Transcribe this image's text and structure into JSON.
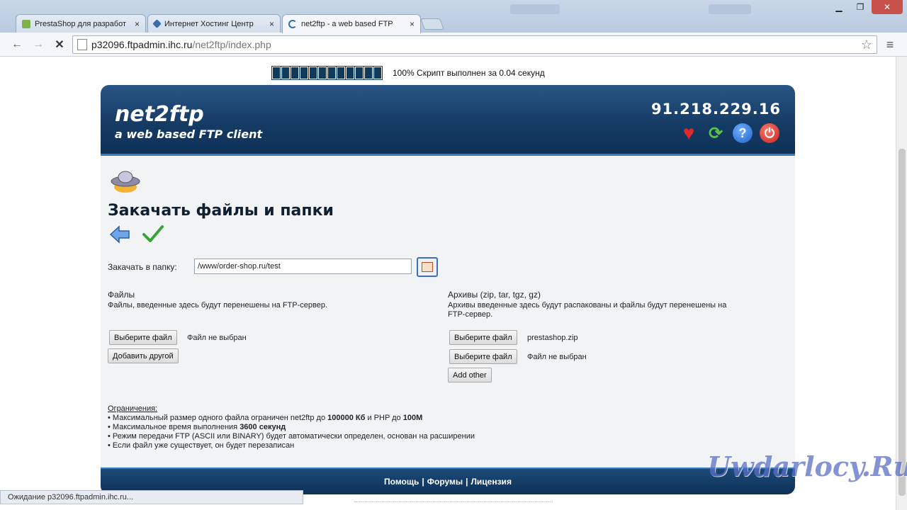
{
  "browser": {
    "tabs": [
      {
        "label": "PrestaShop для разработ",
        "icon_color": "#7fb24a"
      },
      {
        "label": "Интернет Хостинг Центр",
        "icon_color": "#3b6ea8"
      },
      {
        "label": "net2ftp - a web based FTP",
        "icon_color": "#2a6fb0"
      }
    ],
    "tab_close": "×",
    "url_host": "p32096.ftpadmin.ihc.ru",
    "url_path": "/net2ftp/index.php",
    "status_text": "Ожидание p32096.ftpadmin.ihc.ru..."
  },
  "page": {
    "progress": {
      "percent": 100,
      "blocks": 12,
      "text": "100% Скрипт выполнен за 0.04 секунд"
    },
    "logo_line1": "net2ftp",
    "logo_line2": "a web based FTP client",
    "ip": "91.218.229.16",
    "title": "Закачать файлы и папки",
    "dir_label": "Закачать в папку:",
    "dir_value": "/www/order-shop.ru/test",
    "files": {
      "heading": "Файлы",
      "description": "Файлы, введенные здесь будут перенешены на FTP-сервер.",
      "choose_button": "Выберите файл",
      "status": "Файл не выбран",
      "add_button": "Добавить другой"
    },
    "archives": {
      "heading": "Архивы (zip, tar, tgz, gz)",
      "description_line1": "Архивы введенные здесь будут распакованы и файлы будут перенешены на",
      "description_line2": "FTP-сервер.",
      "choose_button_1": "Выберите файл",
      "status_1": "prestashop.zip",
      "choose_button_2": "Выберите файл",
      "status_2": "Файл не выбран",
      "add_button": "Add other"
    },
    "limits": {
      "heading": "Ограничения:",
      "item1_prefix": "Максимальный размер одного файла ограничен net2ftp до ",
      "item1_bold1": "100000 Кб",
      "item1_mid": " и PHP до ",
      "item1_bold2": "100M",
      "item2_prefix": "Максимальное время выполнения ",
      "item2_bold": "3600 секунд",
      "item3": "Режим передачи FTP (ASCII или BINARY) будет автоматически определен, основан на расширении",
      "item4": "Если файл уже существует, он будет перезаписан"
    },
    "footer": {
      "help": "Помощь",
      "sep1": "|",
      "forums": "Форумы",
      "sep2": "|",
      "license": "Лицензия"
    }
  },
  "watermark": "Uwdarlocy.Ru"
}
